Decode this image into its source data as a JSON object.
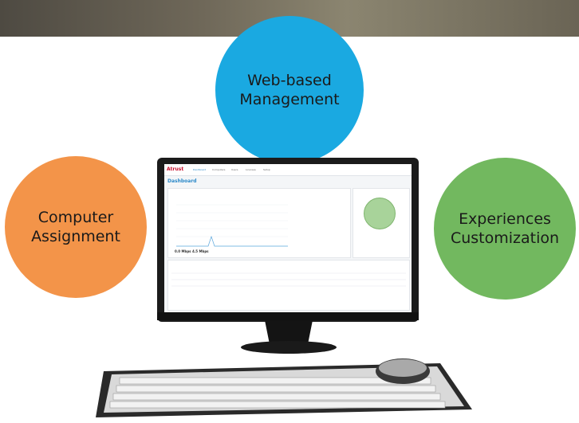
{
  "features": {
    "web_line1": "Web-based",
    "web_line2": "Management",
    "comp_line1": "Computer",
    "comp_line2": "Assignment",
    "exp_line1": "Experiences",
    "exp_line2": "Customization"
  },
  "dashboard": {
    "logo": "Atrust",
    "title": "Dashboard",
    "nav": [
      "Dashboard",
      "Computers",
      "Users",
      "Licenses",
      "Setup"
    ],
    "metric1_value": "0.0 Mbps",
    "metric2_value": "4.5 Mbps"
  },
  "colors": {
    "web": "#1aa9e1",
    "comp": "#f39449",
    "exp": "#72b85f",
    "banner": "#6f6859"
  }
}
